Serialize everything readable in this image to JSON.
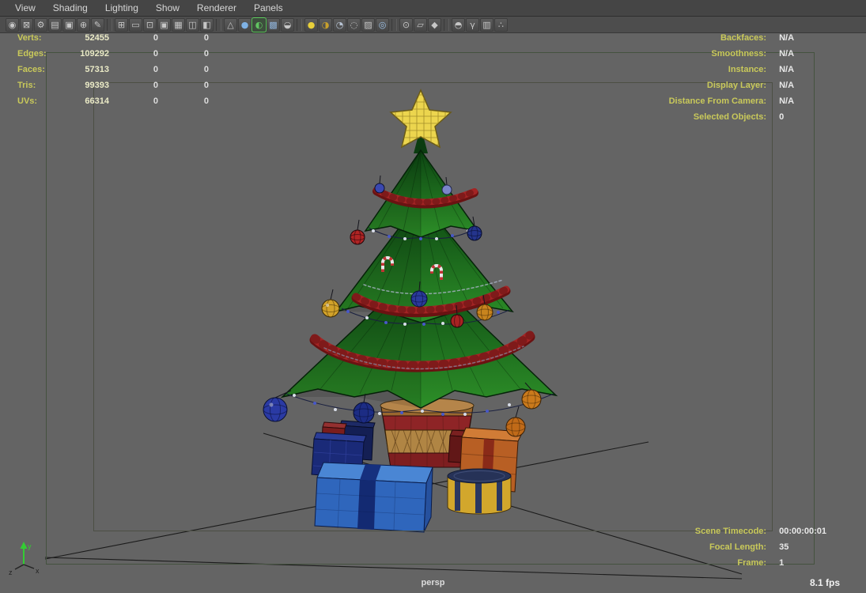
{
  "menubar": {
    "items": [
      {
        "name": "menu-view",
        "label": "View"
      },
      {
        "name": "menu-shading",
        "label": "Shading"
      },
      {
        "name": "menu-lighting",
        "label": "Lighting"
      },
      {
        "name": "menu-show",
        "label": "Show"
      },
      {
        "name": "menu-renderer",
        "label": "Renderer"
      },
      {
        "name": "menu-panels",
        "label": "Panels"
      }
    ]
  },
  "toolbar": {
    "groups": {
      "camera": [
        {
          "name": "select-camera-icon",
          "glyph": "◉",
          "color": "#c6c6c6"
        },
        {
          "name": "lock-camera-icon",
          "glyph": "⊠",
          "color": "#c6c6c6"
        },
        {
          "name": "camera-attributes-icon",
          "glyph": "⚙",
          "color": "#c6c6c6"
        },
        {
          "name": "bookmark-icon",
          "glyph": "▤",
          "color": "#c6c6c6"
        },
        {
          "name": "image-plane-icon",
          "glyph": "▣",
          "color": "#c6c6c6"
        },
        {
          "name": "pan-zoom-icon",
          "glyph": "⊕",
          "color": "#c6c6c6"
        },
        {
          "name": "grease-pencil-icon",
          "glyph": "✎",
          "color": "#c6c6c6"
        }
      ],
      "gates": [
        {
          "name": "grid-icon",
          "glyph": "⊞",
          "color": "#c6c6c6"
        },
        {
          "name": "film-gate-icon",
          "glyph": "▭",
          "color": "#c6c6c6"
        },
        {
          "name": "resolution-gate-icon",
          "glyph": "⊡",
          "color": "#c6c6c6"
        },
        {
          "name": "gate-mask-icon",
          "glyph": "▣",
          "color": "#c6c6c6"
        },
        {
          "name": "field-chart-icon",
          "glyph": "▦",
          "color": "#c6c6c6"
        },
        {
          "name": "safe-action-icon",
          "glyph": "◫",
          "color": "#c6c6c6"
        },
        {
          "name": "safe-title-icon",
          "glyph": "◧",
          "color": "#c6c6c6"
        }
      ],
      "shading": [
        {
          "name": "wireframe-icon",
          "glyph": "△",
          "color": "#c6c6c6"
        },
        {
          "name": "smooth-shade-icon",
          "glyph": "●",
          "color": "#7fb2e5"
        },
        {
          "name": "wireframe-on-shaded-icon",
          "glyph": "◐",
          "color": "#62c462",
          "active": true
        },
        {
          "name": "textured-icon",
          "glyph": "▩",
          "color": "#8fb2d8"
        },
        {
          "name": "default-material-icon",
          "glyph": "◒",
          "color": "#c6c6c6"
        }
      ],
      "lighting": [
        {
          "name": "lights-icon",
          "glyph": "●",
          "color": "#e8cf3a"
        },
        {
          "name": "shadows-icon",
          "glyph": "◑",
          "color": "#c8a02c"
        },
        {
          "name": "ambient-occlusion-icon",
          "glyph": "◔",
          "color": "#b8c4d4"
        },
        {
          "name": "motion-blur-icon",
          "glyph": "◌",
          "color": "#c6c6c6"
        },
        {
          "name": "multisample-icon",
          "glyph": "▨",
          "color": "#c6c6c6"
        },
        {
          "name": "depth-of-field-icon",
          "glyph": "◎",
          "color": "#9fc4ea"
        }
      ],
      "isolate": [
        {
          "name": "isolate-select-icon",
          "glyph": "⊙",
          "color": "#c6c6c6"
        },
        {
          "name": "xray-icon",
          "glyph": "▱",
          "color": "#c6c6c6"
        },
        {
          "name": "xray-joints-icon",
          "glyph": "◆",
          "color": "#c6c6c6"
        }
      ],
      "misc": [
        {
          "name": "exposure-icon",
          "glyph": "◓",
          "color": "#c6c6c6"
        },
        {
          "name": "gamma-icon",
          "glyph": "γ",
          "color": "#c6c6c6"
        },
        {
          "name": "snapshot-icon",
          "glyph": "▥",
          "color": "#c6c6c6"
        },
        {
          "name": "share-icon",
          "glyph": "∴",
          "color": "#c6c6c6"
        }
      ]
    }
  },
  "hud": {
    "left": [
      {
        "name": "hud-verts",
        "label": "Verts:",
        "v1": "52455",
        "v2": "0",
        "v3": "0"
      },
      {
        "name": "hud-edges",
        "label": "Edges:",
        "v1": "109292",
        "v2": "0",
        "v3": "0"
      },
      {
        "name": "hud-faces",
        "label": "Faces:",
        "v1": "57313",
        "v2": "0",
        "v3": "0"
      },
      {
        "name": "hud-tris",
        "label": "Tris:",
        "v1": "99393",
        "v2": "0",
        "v3": "0"
      },
      {
        "name": "hud-uvs",
        "label": "UVs:",
        "v1": "66314",
        "v2": "0",
        "v3": "0"
      }
    ],
    "right": [
      {
        "name": "hud-backfaces",
        "label": "Backfaces:",
        "value": "N/A"
      },
      {
        "name": "hud-smoothness",
        "label": "Smoothness:",
        "value": "N/A"
      },
      {
        "name": "hud-instance",
        "label": "Instance:",
        "value": "N/A"
      },
      {
        "name": "hud-display-layer",
        "label": "Display Layer:",
        "value": "N/A"
      },
      {
        "name": "hud-distance-from-camera",
        "label": "Distance From Camera:",
        "value": "N/A"
      },
      {
        "name": "hud-selected-objects",
        "label": "Selected Objects:",
        "value": "0"
      }
    ],
    "bottom_right": [
      {
        "name": "hud-scene-timecode",
        "label": "Scene Timecode:",
        "value": "00:00:00:01"
      },
      {
        "name": "hud-focal-length",
        "label": "Focal Length:",
        "value": "35"
      },
      {
        "name": "hud-frame",
        "label": "Frame:",
        "value": "1"
      }
    ],
    "camera_name": "persp",
    "fps": "8.1 fps"
  },
  "axis": {
    "x": "x",
    "y": "y",
    "z": "z"
  },
  "colors": {
    "hud_label": "#c9c95a",
    "viewport_bg": "#646464",
    "active_icon_ring": "#55cc55"
  }
}
